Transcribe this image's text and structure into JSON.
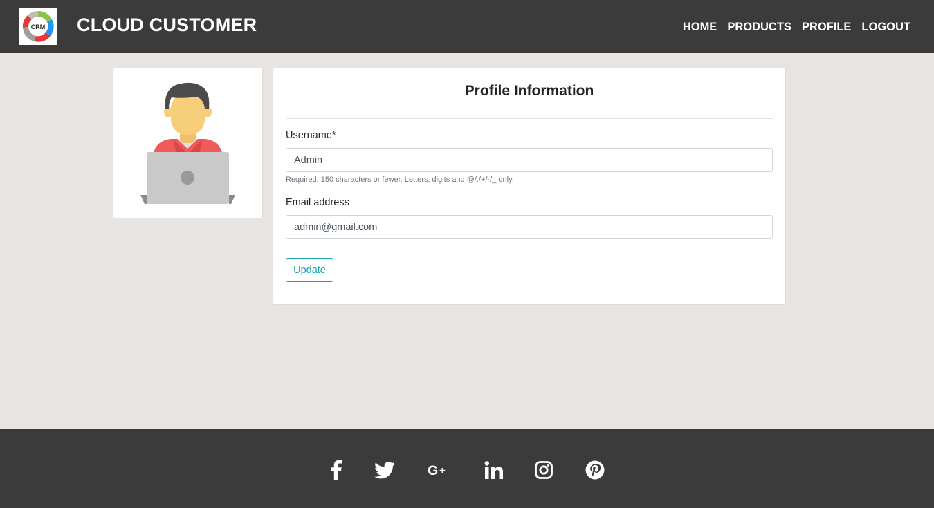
{
  "header": {
    "brand": "CLOUD CUSTOMER",
    "logo_text": "CRM",
    "nav": [
      "HOME",
      "PRODUCTS",
      "PROFILE",
      "LOGOUT"
    ]
  },
  "profile": {
    "title": "Profile Information",
    "username_label": "Username*",
    "username_value": "Admin",
    "username_help": "Required. 150 characters or fewer. Letters, digits and @/./+/-/_ only.",
    "email_label": "Email address",
    "email_value": "admin@gmail.com",
    "update_label": "Update"
  },
  "footer": {
    "social_icons": [
      "facebook-icon",
      "twitter-icon",
      "google-plus-icon",
      "linkedin-icon",
      "instagram-icon",
      "pinterest-icon"
    ]
  },
  "colors": {
    "navbar_bg": "#3b3b3b",
    "page_bg": "#e8e4e2",
    "accent": "#17a2b8"
  }
}
